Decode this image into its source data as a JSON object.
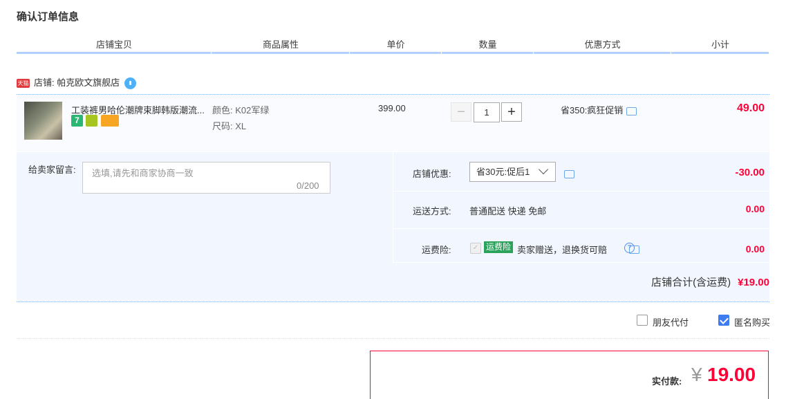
{
  "page": {
    "title": "确认订单信息"
  },
  "table_headers": [
    "店铺宝贝",
    "商品属性",
    "单价",
    "数量",
    "优惠方式",
    "小计"
  ],
  "shop": {
    "badge": "天猫",
    "label": "店铺: 帕克欧文旗舰店"
  },
  "item": {
    "title": "工装裤男哈伦潮牌束脚韩版潮流...",
    "service_badge": "7",
    "attr_color": "颜色: K02军绿",
    "attr_size": "尺码: XL",
    "price": "399.00",
    "quantity": "1",
    "qty_minus": "−",
    "qty_plus": "+",
    "promo": "省350:疯狂促销",
    "subtotal": "49.00"
  },
  "message": {
    "label": "给卖家留言:",
    "placeholder": "选填,请先和商家协商一致",
    "counter": "0/200"
  },
  "shop_discount": {
    "label": "店铺优惠:",
    "selected": "省30元:促后1",
    "amount": "-30.00"
  },
  "shipping": {
    "label": "运送方式:",
    "value": "普通配送 快递 免邮",
    "amount": "0.00"
  },
  "insurance": {
    "label": "运费险:",
    "checkmark": "✓",
    "tag": "运费险",
    "desc": "卖家赠送，退换货可赔",
    "help": "?",
    "amount": "0.00"
  },
  "shop_total": {
    "label": "店铺合计(含运费)",
    "value": "¥19.00"
  },
  "options": {
    "friend_pay": "朋友代付",
    "anonymous": "匿名购买"
  },
  "payment": {
    "label": "实付款:",
    "currency": "¥",
    "amount": "19.00"
  },
  "colors": {
    "accent": "#ff0036",
    "header_line": "#b2d1ff",
    "panel_bg": "#f2f7ff",
    "check_blue": "#3d7bf0"
  }
}
